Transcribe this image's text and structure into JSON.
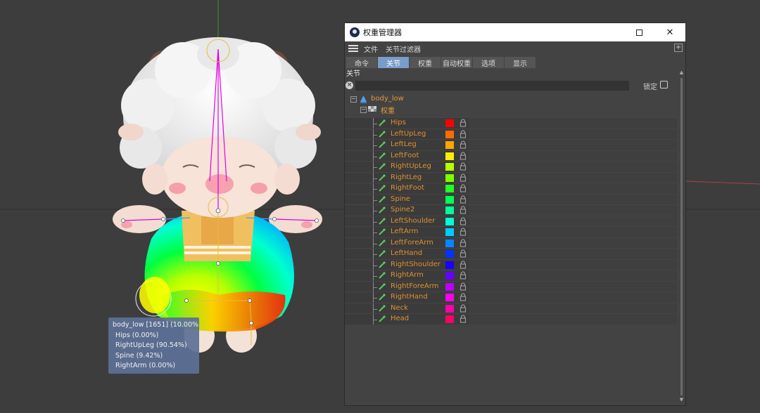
{
  "tooltip": {
    "lines": [
      "body_low [1651] (10.00%)",
      "Hips (0.00%)",
      "RightUpLeg (90.54%)",
      "Spine (9.42%)",
      "RightArm (0.00%)"
    ]
  },
  "panel": {
    "title": "权重管理器",
    "close_glyph": "✕",
    "menu": [
      "文件",
      "关节过滤器"
    ],
    "add_glyph": "+",
    "tabs": [
      {
        "label": "命令",
        "active": false
      },
      {
        "label": "关节",
        "active": true
      },
      {
        "label": "权重",
        "active": false
      },
      {
        "label": "自动权重",
        "active": false
      },
      {
        "label": "选项",
        "active": false
      },
      {
        "label": "显示",
        "active": false
      }
    ],
    "section_label": "关节",
    "search": {
      "value": "",
      "clear_glyph": "×"
    },
    "lock_label": "锁定",
    "tree": {
      "root_label": "body_low",
      "tag_label": "权重",
      "collapse_glyph": "−",
      "joints": [
        {
          "name": "Hips",
          "color": "#ff0000"
        },
        {
          "name": "LeftUpLeg",
          "color": "#ff6a00"
        },
        {
          "name": "LeftLeg",
          "color": "#ffa500"
        },
        {
          "name": "LeftFoot",
          "color": "#ffee00"
        },
        {
          "name": "RightUpLeg",
          "color": "#b8ff00"
        },
        {
          "name": "RightLeg",
          "color": "#7cff00"
        },
        {
          "name": "RightFoot",
          "color": "#22ff22"
        },
        {
          "name": "Spine",
          "color": "#00ff55"
        },
        {
          "name": "Spine2",
          "color": "#00ff99"
        },
        {
          "name": "LeftShoulder",
          "color": "#00ffd5"
        },
        {
          "name": "LeftArm",
          "color": "#00ccff"
        },
        {
          "name": "LeftForeArm",
          "color": "#0088ff"
        },
        {
          "name": "LeftHand",
          "color": "#0033ff"
        },
        {
          "name": "RightShoulder",
          "color": "#1a00ff"
        },
        {
          "name": "RightArm",
          "color": "#6600ff"
        },
        {
          "name": "RightForeArm",
          "color": "#bb00ff"
        },
        {
          "name": "RightHand",
          "color": "#ff00ee"
        },
        {
          "name": "Neck",
          "color": "#ff00aa"
        },
        {
          "name": "Head",
          "color": "#ff0066"
        }
      ]
    },
    "scroll_up_glyph": "▲",
    "scroll_down_glyph": "▼"
  }
}
